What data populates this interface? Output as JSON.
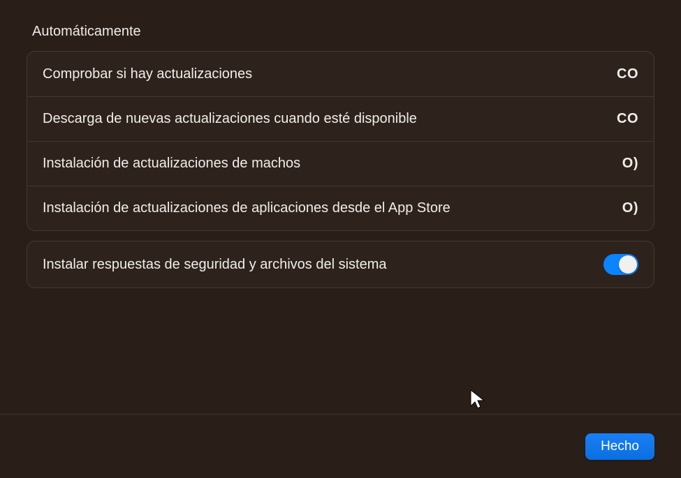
{
  "section": {
    "title": "Automáticamente",
    "rows": [
      {
        "label": "Comprobar si hay actualizaciones",
        "value_text": "CO"
      },
      {
        "label": "Descarga de nuevas actualizaciones cuando esté disponible",
        "value_text": "CO"
      },
      {
        "label": "Instalación de actualizaciones de machos",
        "value_text": "O)"
      },
      {
        "label": "Instalación de actualizaciones de aplicaciones desde el App Store",
        "value_text": "O)"
      }
    ],
    "security_row": {
      "label": "Instalar respuestas de seguridad y archivos del sistema",
      "toggle_on": true
    }
  },
  "footer": {
    "done_label": "Hecho"
  }
}
